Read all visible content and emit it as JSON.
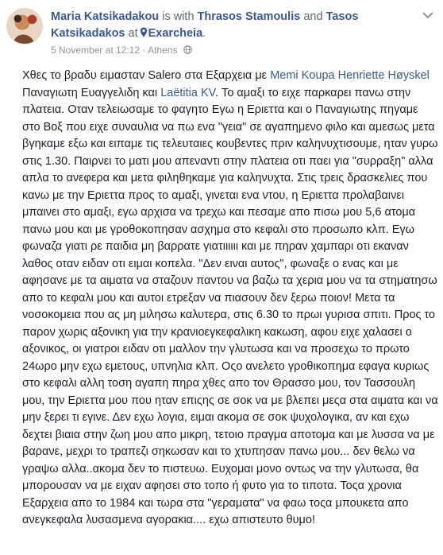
{
  "post": {
    "author": "Maria Katsikadakou",
    "is_with": "is with",
    "tag1": "Thrasos Stamoulis",
    "and": "and",
    "tag2": "Tasos Katsikadakos",
    "at": "at",
    "place": "Exarcheia",
    "period": ".",
    "timestamp": "5 November at 12:12",
    "dot": "·",
    "location": "Athens",
    "menu_icon": "chevron-down-icon",
    "text_before_tags": "Χθες το βραδυ ειμασταν Salero στα Εξαρχεια με ",
    "tag3": "Memi Koupa",
    "space1": " ",
    "tag4": "Henriette Høyskel",
    "mid1": " Παναγιωτη Ευαγγελιδη και ",
    "tag5": "Laëtitia KV",
    "text_after_tags": ". Το αμαξι το ειχε παρκαρει πανω στην πλατεια. Οταν τελειωσαμε το φαγητο Εγω η Εριεττα και ο Παναγιωτης πηγαμε στο Βοξ που ειχε συναυλια να πω ενα \"γεια\" σε αγαπημενο φιλο και αμεσως μετα βγηκαμε εξω και ειπαμε τις τελευταιες κουβεντες πριν καληνυχτισουμε, ηταν γυρω στις 1.30. Παιρνει το ματι μου απεναντι στην πλατεια οτι παει για \"συρραξη\" αλλα απλα το ανεφερα και μετα φιληθηκαμε για καληνυχτα. Στις τρεις δρασκελιες που κανω με την Εριεττα προς το αμαξι, γινεται ενα ντου, η Εριεττα προλαβαινει μπαινει στο αμαξι, εγω αρχισα να τρεχω και πεσαμε απο πισω μου 5,6 ατομα πανω μου και με γροθοκοπησαν ασχημα στο κεφαλι στο προσωπο κλπ. Εγω φωναζα γιατι ρε παιδια μη βαρρατε γιατιιιιιι και με πηραν χαμπαρι οτι εκαναν λαθος οταν ειδαν οτι ειμαι κοπελα. \"Δεν ειναι αυτος\", φωναξε ο ενας και με αφησανε με τα αιματα να σταζουν παντου να βαζω τα χερια μου να τα στηματησω απο το κεφαλι μου και αυτοι ετρεξαν να πιασουν δεν ξερω ποιον! Μετα τα νοσοκομεια που ας μη μιλησω καλυτερα, στις 6.30 το πρωι γυρισα σπιτι. Προς το παρον χωρις αξονικη για την κρανιοεγκεφαλικη κακωση, αφου ειχε χαλασει ο αξονικος, οι γιατροι ειδαν οτι μαλλον την γλυτωσα και να προσεχω το πρωτο 24ωρο μην εχω εμετους, υπνηλια κλπ. Οςο ανελετο γροθικοπημα εφαγα κυριως στο κεφαλι αλλη τοση αγαπη πηρα χθες απο τον Θρασσο μου, τον Τασσουλη μου, την Εριεττα μου που ηταν επιςης σε σοκ να με βλεπει μεςα στα αιματα και να μην ξερει τι εγινε. Δεν εχω λογια, ειμαι ακομα σε σοκ ψυχολογικα, αν και εχω δεχτει βιαια στην ζωη μου απο μικρη, τετοιο πραγμα απoτομα και με λυσσα να με βαρανε, μεχρι το τραπεζι σηκωσαν και το χτυπησαν πανω μου... δεν θελω να γραψω αλλα..ακομα δεν το πιστευω. Ευχομαι μονο οντως να την γλυτωσα, θα μπορουσαν να με ειχαν αφησει στο τοπο ή φυτο για το τιποτα. Τοςα χρονια Εξαρχεια απο το 1984 και τωρα στα \"γεραματα\" να φαω τοςα μπουκετα απο ανεγκεφαλα λυσασμενα αγορακια.... εχω απιστευτο θυμο!"
  }
}
